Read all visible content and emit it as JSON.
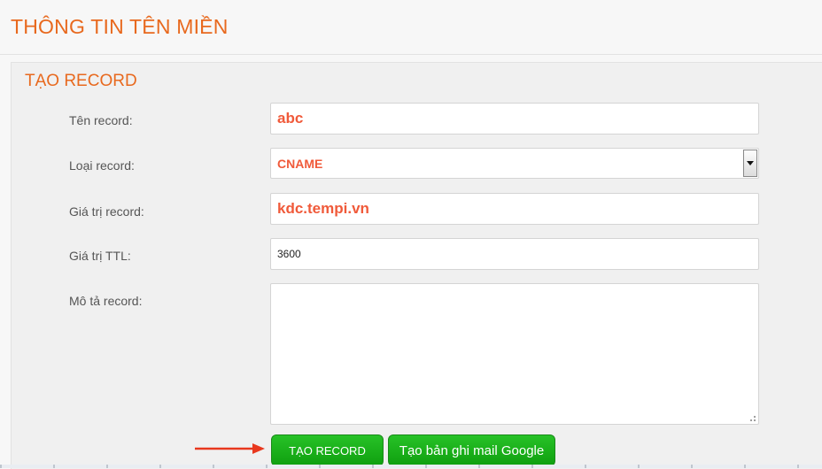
{
  "page": {
    "title": "THÔNG TIN TÊN MIỀN"
  },
  "form": {
    "section_title": "TẠO RECORD",
    "fields": [
      {
        "label": "Tên record:",
        "value": "abc"
      },
      {
        "label": "Loại record:",
        "value": "CNAME"
      },
      {
        "label": "Giá trị record:",
        "value": "kdc.tempi.vn"
      },
      {
        "label": "Giá trị TTL:",
        "value": "3600"
      },
      {
        "label": "Mô tả record:",
        "value": ""
      }
    ],
    "buttons": {
      "create": "TẠO RECORD",
      "google_mail": "Tạo bản ghi mail Google"
    }
  },
  "colors": {
    "accent": "#e8691e",
    "value_highlight": "#f05a3a",
    "button_green": "#1aaf1a",
    "arrow": "#e8381e"
  },
  "icons": {
    "select_arrow": "chevron-down-icon",
    "annotation": "red-arrow-icon",
    "resize": "resize-grip-icon"
  }
}
